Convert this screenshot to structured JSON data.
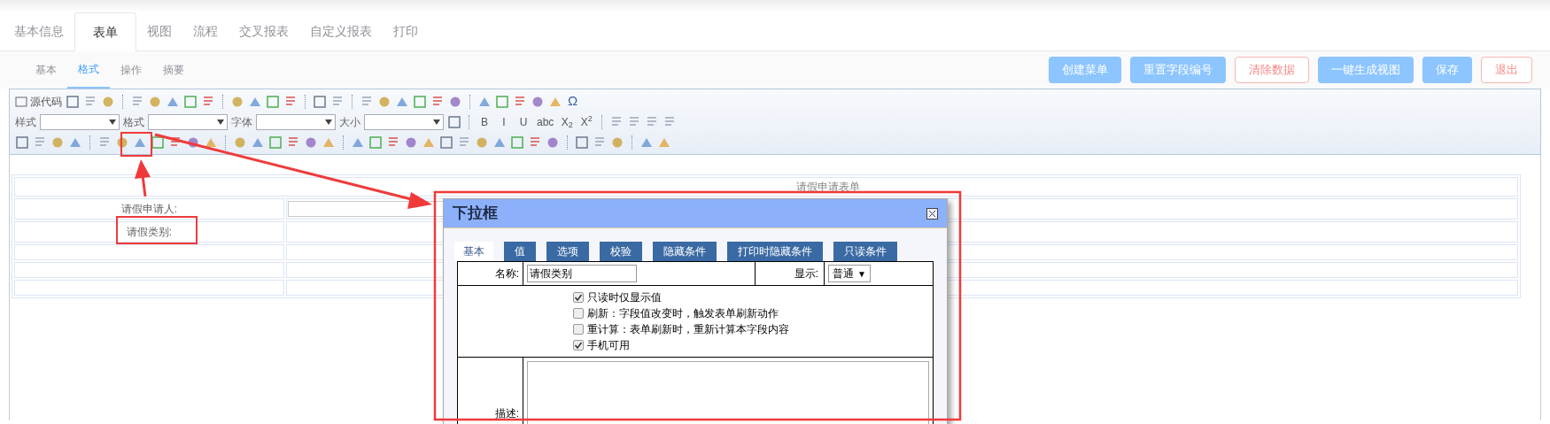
{
  "main_tabs": [
    {
      "label": "基本信息",
      "selected": false
    },
    {
      "label": "表单",
      "selected": true
    },
    {
      "label": "视图",
      "selected": false
    },
    {
      "label": "流程",
      "selected": false
    },
    {
      "label": "交叉报表",
      "selected": false
    },
    {
      "label": "自定义报表",
      "selected": false
    },
    {
      "label": "打印",
      "selected": false
    }
  ],
  "sub_tabs": [
    {
      "label": "基本",
      "selected": false
    },
    {
      "label": "格式",
      "selected": true
    },
    {
      "label": "操作",
      "selected": false
    },
    {
      "label": "摘要",
      "selected": false
    }
  ],
  "actions": [
    {
      "label": "创建菜单",
      "kind": "primary"
    },
    {
      "label": "重置字段编号",
      "kind": "primary"
    },
    {
      "label": "清除数据",
      "kind": "danger"
    },
    {
      "label": "一键生成视图",
      "kind": "primary"
    },
    {
      "label": "保存",
      "kind": "primary"
    },
    {
      "label": "退出",
      "kind": "danger"
    }
  ],
  "editor_toolbar": {
    "source_button": "源代码",
    "special_char": "Ω",
    "dropdowns": [
      {
        "label": "样式"
      },
      {
        "label": "格式"
      },
      {
        "label": "字体"
      },
      {
        "label": "大小"
      }
    ],
    "format_buttons": [
      "B",
      "I",
      "U",
      "abc",
      "X$_{2}$",
      "X$^{2}$"
    ]
  },
  "form": {
    "title": "请假申请表单",
    "rows": [
      {
        "label": "请假申请人:",
        "field": true
      },
      {
        "label": "请假类别:",
        "field": false
      }
    ]
  },
  "dialog": {
    "title": "下拉框",
    "tabs": [
      {
        "label": "基本",
        "selected": true
      },
      {
        "label": "值",
        "selected": false
      },
      {
        "label": "选项",
        "selected": false
      },
      {
        "label": "校验",
        "selected": false
      },
      {
        "label": "隐藏条件",
        "selected": false
      },
      {
        "label": "打印时隐藏条件",
        "selected": false
      },
      {
        "label": "只读条件",
        "selected": false
      }
    ],
    "name_label": "名称:",
    "name_value": "请假类别",
    "display_label": "显示:",
    "display_value": "普通",
    "display_arrow": "▼",
    "options": [
      {
        "label": "只读时仅显示值",
        "checked": true
      },
      {
        "label": "刷新：字段值改变时，触发表单刷新动作",
        "checked": false
      },
      {
        "label": "重计算：表单刷新时，重新计算本字段内容",
        "checked": false
      },
      {
        "label": "手机可用",
        "checked": true
      }
    ],
    "description_label": "描述:"
  }
}
